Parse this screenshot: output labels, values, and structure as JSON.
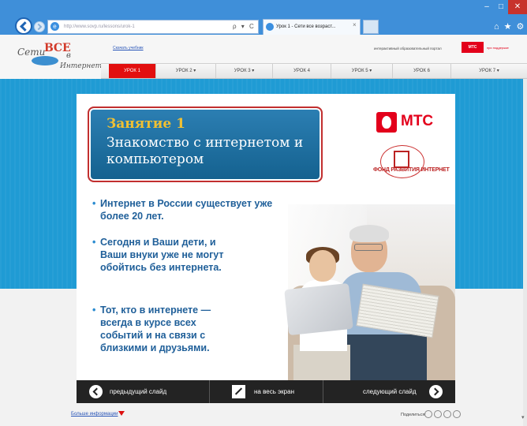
{
  "browser": {
    "address": "http://www.sovp.ru/lessons/urok-1",
    "addr_actions": "ρ ▾ C",
    "tab_title": "Урок 1 - Сети все возраст...",
    "tab_close": "×",
    "win_min": "–",
    "win_max": "□",
    "win_close": "✕",
    "toolbar_icons": "⌂★⚙"
  },
  "header": {
    "logo": {
      "w1": "Сети",
      "w2": "ВСЕ",
      "w3": "в",
      "w4": "Интернет"
    },
    "download_link": "Скачать учебник",
    "portal_text": "интерактивный образовательный портал",
    "mts_badge": "МТС",
    "mts_note": "при поддержке"
  },
  "nav": {
    "items": [
      {
        "label": "УРОК 1"
      },
      {
        "label": "УРОК 2 ▾"
      },
      {
        "label": "УРОК 3 ▾"
      },
      {
        "label": "УРОК 4"
      },
      {
        "label": "УРОК 5 ▾"
      },
      {
        "label": "УРОК 6"
      },
      {
        "label": "УРОК 7 ▾"
      }
    ]
  },
  "slide": {
    "lesson_title": "Занятие 1",
    "lesson_subtitle": "Знакомство с интернетом и компьютером",
    "mts_logo": "МТС",
    "fund_text": "ФОНД РАЗВИТИЯ ИНТЕРНЕТ",
    "bullet": "•",
    "facts": [
      "Интернет в России существует уже более 20 лет.",
      "Сегодня и Ваши дети, и Ваши внуки уже не могут обойтись без интернета.",
      "Тот, кто в интернете — всегда в курсе всех событий и на связи с близкими и друзьями."
    ]
  },
  "controls": {
    "prev": "предыдущий слайд",
    "fullscreen": "на весь экран",
    "next": "следующий слайд"
  },
  "footer": {
    "more_info": "Больше информации",
    "share": "Поделиться:"
  },
  "colors": {
    "accent_red": "#e20f0f",
    "banner_blue": "#1f9bd4",
    "lesson_gold": "#f0c033",
    "fact_blue": "#1f5f99"
  }
}
